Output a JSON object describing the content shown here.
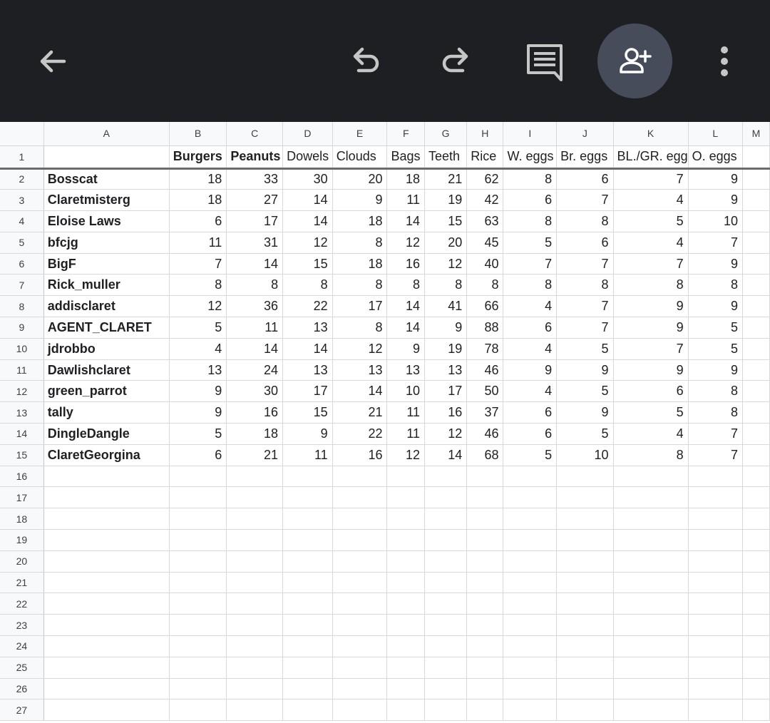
{
  "toolbar": {
    "back_icon": "arrow-left-icon",
    "undo_icon": "undo-icon",
    "redo_icon": "redo-icon",
    "comment_icon": "comment-icon",
    "share_icon": "add-person-icon",
    "more_icon": "more-vert-icon",
    "bg_color": "#1e1f22",
    "share_bg_color": "#474c5b",
    "icon_color": "#c4c7c5"
  },
  "sheet": {
    "columns": [
      "A",
      "B",
      "C",
      "D",
      "E",
      "F",
      "G",
      "H",
      "I",
      "J",
      "K",
      "L",
      "M"
    ],
    "header_row": {
      "row_number": "1",
      "cells": [
        "",
        "Burgers",
        "Peanuts",
        "Dowels",
        "Clouds",
        "Bags",
        "Teeth",
        "Rice",
        "W. eggs",
        "Br. eggs",
        "BL./GR. egg",
        "O. eggs",
        ""
      ],
      "bold": [
        false,
        true,
        true,
        false,
        false,
        false,
        false,
        false,
        false,
        false,
        false,
        false,
        false
      ]
    },
    "rows": [
      {
        "n": "2",
        "name": "Bosscat",
        "values": [
          "18",
          "33",
          "30",
          "20",
          "18",
          "21",
          "62",
          "8",
          "6",
          "7",
          "9"
        ]
      },
      {
        "n": "3",
        "name": "Claretmisterg",
        "values": [
          "18",
          "27",
          "14",
          "9",
          "11",
          "19",
          "42",
          "6",
          "7",
          "4",
          "9"
        ]
      },
      {
        "n": "4",
        "name": "Eloise Laws",
        "values": [
          "6",
          "17",
          "14",
          "18",
          "14",
          "15",
          "63",
          "8",
          "8",
          "5",
          "10"
        ]
      },
      {
        "n": "5",
        "name": "bfcjg",
        "values": [
          "11",
          "31",
          "12",
          "8",
          "12",
          "20",
          "45",
          "5",
          "6",
          "4",
          "7"
        ]
      },
      {
        "n": "6",
        "name": "BigF",
        "values": [
          "7",
          "14",
          "15",
          "18",
          "16",
          "12",
          "40",
          "7",
          "7",
          "7",
          "9"
        ]
      },
      {
        "n": "7",
        "name": "Rick_muller",
        "values": [
          "8",
          "8",
          "8",
          "8",
          "8",
          "8",
          "8",
          "8",
          "8",
          "8",
          "8"
        ]
      },
      {
        "n": "8",
        "name": "addisclaret",
        "values": [
          "12",
          "36",
          "22",
          "17",
          "14",
          "41",
          "66",
          "4",
          "7",
          "9",
          "9"
        ]
      },
      {
        "n": "9",
        "name": "AGENT_CLARET",
        "values": [
          "5",
          "11",
          "13",
          "8",
          "14",
          "9",
          "88",
          "6",
          "7",
          "9",
          "5"
        ]
      },
      {
        "n": "10",
        "name": "jdrobbo",
        "values": [
          "4",
          "14",
          "14",
          "12",
          "9",
          "19",
          "78",
          "4",
          "5",
          "7",
          "5"
        ]
      },
      {
        "n": "11",
        "name": "Dawlishclaret",
        "values": [
          "13",
          "24",
          "13",
          "13",
          "13",
          "13",
          "46",
          "9",
          "9",
          "9",
          "9"
        ]
      },
      {
        "n": "12",
        "name": "green_parrot",
        "values": [
          "9",
          "30",
          "17",
          "14",
          "10",
          "17",
          "50",
          "4",
          "5",
          "6",
          "8"
        ]
      },
      {
        "n": "13",
        "name": "tally",
        "values": [
          "9",
          "16",
          "15",
          "21",
          "11",
          "16",
          "37",
          "6",
          "9",
          "5",
          "8"
        ]
      },
      {
        "n": "14",
        "name": "DingleDangle",
        "values": [
          "5",
          "18",
          "9",
          "22",
          "11",
          "12",
          "46",
          "6",
          "5",
          "4",
          "7"
        ]
      },
      {
        "n": "15",
        "name": "ClaretGeorgina",
        "values": [
          "6",
          "21",
          "11",
          "16",
          "12",
          "14",
          "68",
          "5",
          "10",
          "8",
          "7"
        ]
      }
    ],
    "empty_rows": [
      "16",
      "17",
      "18",
      "19",
      "20",
      "21",
      "22",
      "23",
      "24",
      "25",
      "26",
      "27"
    ]
  }
}
